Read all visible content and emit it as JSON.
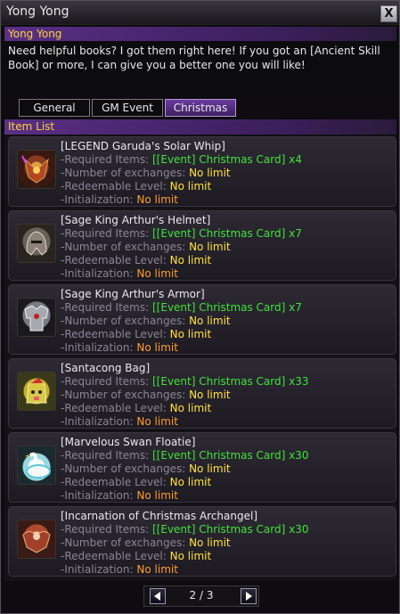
{
  "window": {
    "title": "Yong Yong",
    "close_label": "X"
  },
  "npc": {
    "name": "Yong Yong",
    "dialog": "Need helpful books? I got them right here! If you got an [Ancient Skill Book] or more, I can give you a better one you will like!"
  },
  "tabs": [
    {
      "label": "General",
      "active": false
    },
    {
      "label": "GM Event",
      "active": false
    },
    {
      "label": "Christmas",
      "active": true
    }
  ],
  "list": {
    "header": "Item List",
    "items": [
      {
        "name": "[LEGEND Garuda's Solar Whip]",
        "icon": "solar-whip-icon",
        "required_label": "-Required Items:",
        "required_value": "[[Event] Christmas Card] x4",
        "exchanges_label": "-Number of exchanges:",
        "exchanges_value": "No limit",
        "level_label": "-Redeemable Level:",
        "level_value": "No limit",
        "init_label": "-Initialization:",
        "init_value": "No limit"
      },
      {
        "name": "[Sage King Arthur's Helmet]",
        "icon": "helmet-icon",
        "required_label": "-Required Items:",
        "required_value": "[[Event] Christmas Card] x7",
        "exchanges_label": "-Number of exchanges:",
        "exchanges_value": "No limit",
        "level_label": "-Redeemable Level:",
        "level_value": "No limit",
        "init_label": "-Initialization:",
        "init_value": "No limit"
      },
      {
        "name": "[Sage King Arthur's Armor]",
        "icon": "armor-icon",
        "required_label": "-Required Items:",
        "required_value": "[[Event] Christmas Card] x7",
        "exchanges_label": "-Number of exchanges:",
        "exchanges_value": "No limit",
        "level_label": "-Redeemable Level:",
        "level_value": "No limit",
        "init_label": "-Initialization:",
        "init_value": "No limit"
      },
      {
        "name": "[Santacong Bag]",
        "icon": "santa-bag-icon",
        "required_label": "-Required Items:",
        "required_value": "[[Event] Christmas Card] x33",
        "exchanges_label": "-Number of exchanges:",
        "exchanges_value": "No limit",
        "level_label": "-Redeemable Level:",
        "level_value": "No limit",
        "init_label": "-Initialization:",
        "init_value": "No limit"
      },
      {
        "name": "[Marvelous Swan Floatie]",
        "icon": "swan-floatie-icon",
        "required_label": "-Required Items:",
        "required_value": "[[Event] Christmas Card] x30",
        "exchanges_label": "-Number of exchanges:",
        "exchanges_value": "No limit",
        "level_label": "-Redeemable Level:",
        "level_value": "No limit",
        "init_label": "-Initialization:",
        "init_value": "No limit"
      },
      {
        "name": "[Incarnation of Christmas Archangel]",
        "icon": "archangel-icon",
        "required_label": "-Required Items:",
        "required_value": "[[Event] Christmas Card] x30",
        "exchanges_label": "-Number of exchanges:",
        "exchanges_value": "No limit",
        "level_label": "-Redeemable Level:",
        "level_value": "No limit",
        "init_label": "-Initialization:",
        "init_value": "No limit"
      }
    ]
  },
  "pager": {
    "text": "2 / 3",
    "prev_icon": "arrow-left-icon",
    "next_icon": "arrow-right-icon"
  },
  "colors": {
    "accent_purple": "#5a2f86",
    "header_yellow": "#ffd23c",
    "value_green": "#41e23b",
    "value_yellow": "#ffe23c",
    "value_orange": "#ff9f2a"
  }
}
